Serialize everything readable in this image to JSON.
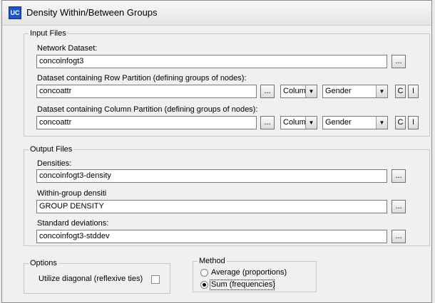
{
  "window": {
    "title": "Density Within/Between Groups",
    "app_icon_text": "UC"
  },
  "input_files": {
    "legend": "Input Files",
    "network_label": "Network Dataset:",
    "network_value": "concoinfogt3",
    "row_label": "Dataset containing Row Partition (defining groups of nodes):",
    "row_value": "concoattr",
    "row_dim": "Columi",
    "row_attr": "Gender",
    "col_label": "Dataset containing Column Partition (defining groups of nodes):",
    "col_value": "concoattr",
    "col_dim": "Columi",
    "col_attr": "Gender",
    "browse": "...",
    "c_label": "C",
    "i_label": "I"
  },
  "output_files": {
    "legend": "Output Files",
    "densities_label": "Densities:",
    "densities_value": "concoinfogt3-density",
    "within_label": "Within-group densiti",
    "within_value": "GROUP DENSITY",
    "stddev_label": "Standard deviations:",
    "stddev_value": "concoinfogt3-stddev",
    "browse": "..."
  },
  "options": {
    "legend": "Options",
    "diagonal_label": "Utilize diagonal (reflexive ties)",
    "diagonal_checked": false
  },
  "method": {
    "legend": "Method",
    "average_label": "Average (proportions)",
    "sum_label": "Sum (frequencies)",
    "selected": "sum"
  }
}
